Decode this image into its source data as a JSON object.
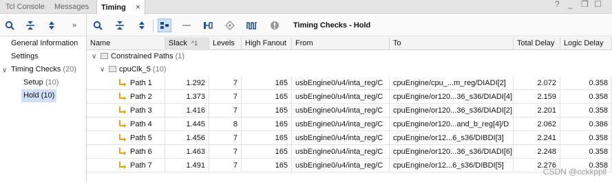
{
  "tabs": [
    {
      "label": "Tcl Console",
      "active": false
    },
    {
      "label": "Messages",
      "active": false
    },
    {
      "label": "Timing",
      "active": true,
      "close": "×"
    }
  ],
  "window_controls": {
    "help": "?",
    "minimize": "_",
    "restore": "❐",
    "maximize": "☐"
  },
  "left_toolbar": {
    "icons": [
      "search-icon",
      "collapse-all-icon",
      "expand-all-icon",
      "overflow-chevron-icon"
    ],
    "overflow_label": "»"
  },
  "right_toolbar": {
    "icons": [
      "search-icon",
      "collapse-all-icon",
      "expand-all-icon",
      "group-view-icon",
      "minus-icon",
      "schematic-icon",
      "highlight-icon",
      "waveform-icon",
      "info-icon"
    ],
    "title": "Timing Checks - Hold"
  },
  "left_tree": {
    "items": [
      {
        "label": "General Information",
        "count": ""
      },
      {
        "label": "Settings",
        "count": ""
      },
      {
        "label": "Timing Checks",
        "count": "(20)",
        "chevron": "∨"
      },
      {
        "label": "Setup",
        "count": "(10)"
      },
      {
        "label": "Hold",
        "count": "(10)",
        "selected": true
      }
    ]
  },
  "grid": {
    "columns": [
      "Name",
      "Slack",
      "Levels",
      "High Fanout",
      "From",
      "To",
      "Total Delay",
      "Logic Delay"
    ],
    "sort": {
      "column": "Slack",
      "indicator": "^1"
    },
    "groups": [
      {
        "label": "Constrained Paths",
        "count": "(1)",
        "chevron": "∨"
      },
      {
        "label": "cpuClk_5",
        "count": "(10)",
        "chevron": "∨"
      }
    ],
    "rows": [
      {
        "name": "Path 1",
        "slack": "1.292",
        "levels": "7",
        "fanout": "165",
        "from": "usbEngine0/u4/inta_reg/C",
        "to": "cpuEngine/cpu_...m_reg/DIADI[2]",
        "total": "2.072",
        "logic": "0.358"
      },
      {
        "name": "Path 2",
        "slack": "1.373",
        "levels": "7",
        "fanout": "165",
        "from": "usbEngine0/u4/inta_reg/C",
        "to": "cpuEngine/or120...36_s36/DIADI[4]",
        "total": "2.159",
        "logic": "0.358"
      },
      {
        "name": "Path 3",
        "slack": "1.416",
        "levels": "7",
        "fanout": "165",
        "from": "usbEngine0/u4/inta_reg/C",
        "to": "cpuEngine/or120...36_s36/DIADI[2]",
        "total": "2.201",
        "logic": "0.358"
      },
      {
        "name": "Path 4",
        "slack": "1.445",
        "levels": "8",
        "fanout": "165",
        "from": "usbEngine0/u4/inta_reg/C",
        "to": "cpuEngine/or120...and_b_reg[4]/D",
        "total": "2.062",
        "logic": "0.386"
      },
      {
        "name": "Path 5",
        "slack": "1.456",
        "levels": "7",
        "fanout": "165",
        "from": "usbEngine0/u4/inta_reg/C",
        "to": "cpuEngine/or12...6_s36/DIBDI[3]",
        "total": "2.241",
        "logic": "0.358"
      },
      {
        "name": "Path 6",
        "slack": "1.463",
        "levels": "7",
        "fanout": "165",
        "from": "usbEngine0/u4/inta_reg/C",
        "to": "cpuEngine/or120...36_s36/DIADI[6]",
        "total": "2.248",
        "logic": "0.358"
      },
      {
        "name": "Path 7",
        "slack": "1.491",
        "levels": "7",
        "fanout": "165",
        "from": "usbEngine0/u4/inta_reg/C",
        "to": "cpuEngine/or12...6_s36/DIBDI[5]",
        "total": "2.276",
        "logic": "0.358"
      }
    ]
  },
  "watermark": "CSDN @cckkppll",
  "colors": {
    "accent": "#1f4e99",
    "selection": "#cfe0f7",
    "path_icon": "#e8a317"
  }
}
